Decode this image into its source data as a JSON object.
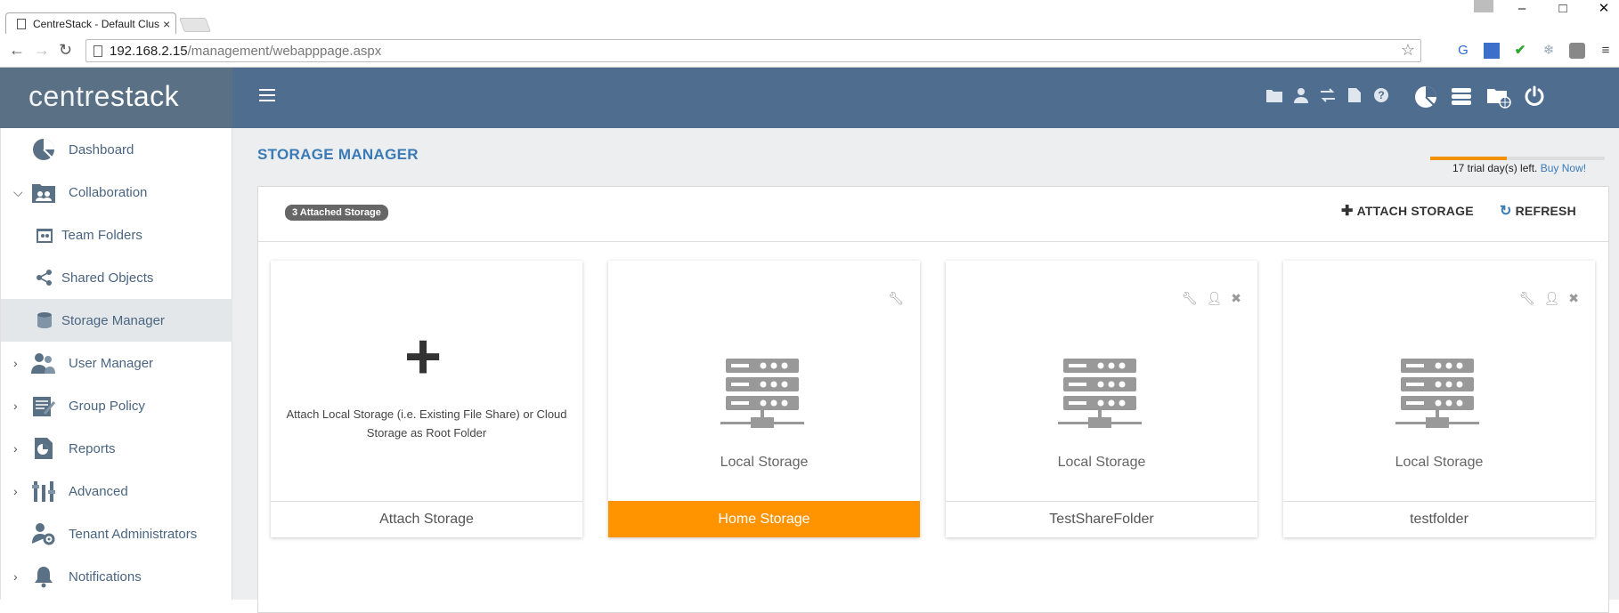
{
  "browser": {
    "tab_title": "CentreStack - Default Clus",
    "tab_close": "×",
    "url_host": "192.168.2.15",
    "url_path": "/management/webapppage.aspx",
    "window_controls": [
      "–",
      "□",
      "✕"
    ]
  },
  "app": {
    "logo_light": "centre",
    "logo_bold": "stack",
    "header_icons": [
      "folder-icon",
      "user-icon",
      "transfer-icon",
      "document-icon",
      "help-icon",
      "chart-pie-icon",
      "database-stack-icon",
      "folder-globe-icon",
      "power-icon"
    ]
  },
  "sidebar": {
    "items": [
      {
        "label": "Dashboard",
        "icon": "dashboard-icon"
      },
      {
        "label": "Collaboration",
        "icon": "collaboration-icon"
      },
      {
        "label": "Team Folders",
        "icon": "team-folders-icon"
      },
      {
        "label": "Shared Objects",
        "icon": "share-icon"
      },
      {
        "label": "Storage Manager",
        "icon": "storage-icon"
      },
      {
        "label": "User Manager",
        "icon": "users-icon"
      },
      {
        "label": "Group Policy",
        "icon": "group-policy-icon"
      },
      {
        "label": "Reports",
        "icon": "reports-icon"
      },
      {
        "label": "Advanced",
        "icon": "tools-icon"
      },
      {
        "label": "Tenant Administrators",
        "icon": "tenant-admin-icon"
      },
      {
        "label": "Notifications",
        "icon": "bell-icon"
      }
    ]
  },
  "main": {
    "title": "STORAGE MANAGER",
    "trial_text": "17 trial day(s) left.",
    "trial_link": "Buy Now!",
    "trial_progress": 0.44,
    "badge": "3 Attached Storage",
    "attach_label": "ATTACH STORAGE",
    "refresh_label": "REFRESH"
  },
  "cards": [
    {
      "footer": "Attach Storage",
      "description": "Attach Local Storage (i.e. Existing File Share) or Cloud Storage as Root Folder"
    },
    {
      "footer": "Home Storage",
      "type": "Local Storage",
      "selected": true
    },
    {
      "footer": "TestShareFolder",
      "type": "Local Storage"
    },
    {
      "footer": "testfolder",
      "type": "Local Storage"
    }
  ],
  "colors": {
    "header": "#4f6d8e",
    "logo_bg": "#5a7084",
    "accent": "#3a7ab5",
    "selected": "#ff9300"
  }
}
